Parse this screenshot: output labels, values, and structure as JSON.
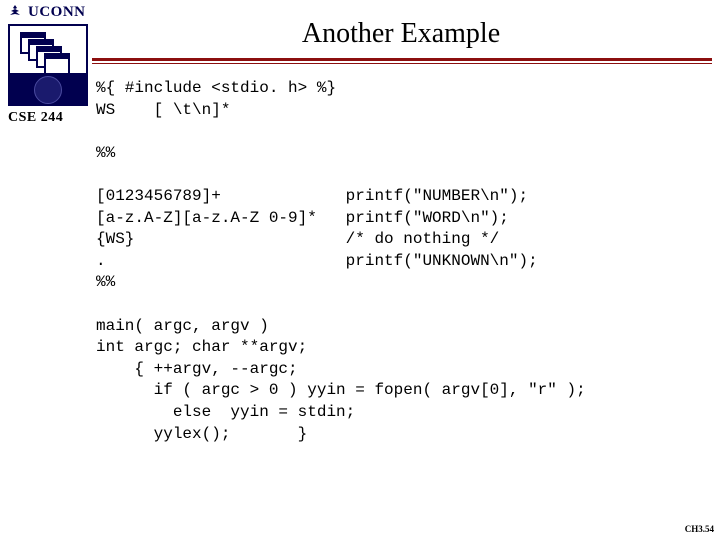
{
  "uconn_label": "UCONN",
  "course_label": "CSE 244",
  "title": "Another Example",
  "code_block": "%{ #include <stdio. h> %}\nWS    [ \\t\\n]*\n\n%%\n\n[0123456789]+             printf(\"NUMBER\\n\");\n[a-z.A-Z][a-z.A-Z 0-9]*   printf(\"WORD\\n\");\n{WS}                      /* do nothing */\n.                         printf(\"UNKNOWN\\n\");\n%%\n\nmain( argc, argv )\nint argc; char **argv;\n    { ++argv, --argc;\n      if ( argc > 0 ) yyin = fopen( argv[0], \"r\" );\n        else  yyin = stdin;\n      yylex();       }",
  "footer": "CH3.54"
}
